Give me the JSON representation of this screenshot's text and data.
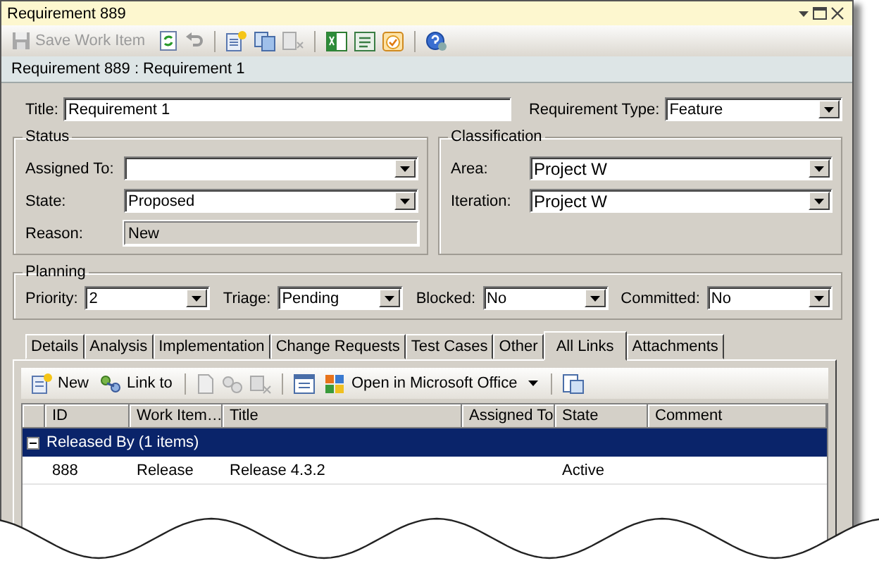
{
  "window": {
    "title": "Requirement 889"
  },
  "toolbar": {
    "save": {
      "label": "Save Work Item",
      "disabled": true
    }
  },
  "breadcrumb": "Requirement 889 : Requirement 1",
  "title_field": {
    "label": "Title:",
    "value": "Requirement 1"
  },
  "type_field": {
    "label": "Requirement Type:",
    "value": "Feature"
  },
  "groups": [
    {
      "title": "Status",
      "fields": [
        {
          "label": "Assigned To:",
          "kind": "dropdown"
        },
        {
          "label": "State:",
          "value": "Proposed",
          "kind": "dropdown"
        },
        {
          "label": "Reason:",
          "value": "New",
          "kind": "readonly"
        }
      ]
    },
    {
      "title": "Classification",
      "fields": [
        {
          "label": "Area:",
          "value": "Project W",
          "kind": "dropdown"
        },
        {
          "label": "Iteration:",
          "value": "Project W",
          "kind": "dropdown"
        }
      ]
    }
  ],
  "planning": {
    "title": "Planning",
    "fields": [
      {
        "label": "Priority:",
        "value": "2"
      },
      {
        "label": "Triage:",
        "value": "Pending"
      },
      {
        "label": "Blocked:",
        "value": "No"
      },
      {
        "label": "Committed:",
        "value": "No"
      }
    ]
  },
  "tabs": [
    {
      "label": "Details",
      "selected": false
    },
    {
      "label": "Analysis",
      "selected": false
    },
    {
      "label": "Implementation",
      "selected": false
    },
    {
      "label": "Change Requests",
      "selected": false
    },
    {
      "label": "Test Cases",
      "selected": false
    },
    {
      "label": "Other",
      "selected": false
    },
    {
      "label": "All Links",
      "selected": true
    },
    {
      "label": "Attachments",
      "selected": false
    }
  ],
  "links_toolbar": {
    "new": "New",
    "link_to": "Link to",
    "open_in_office": "Open in Microsoft Office"
  },
  "table": {
    "columns": [
      "ID",
      "Work Item…",
      "Title",
      "Assigned To",
      "State",
      "Comment"
    ],
    "groups": [
      {
        "title": "Released By (1 items)",
        "expanded": true,
        "rows": [
          {
            "id": "888",
            "type": "Release",
            "title": "Release 4.3.2",
            "state": "Active"
          }
        ]
      }
    ]
  }
}
